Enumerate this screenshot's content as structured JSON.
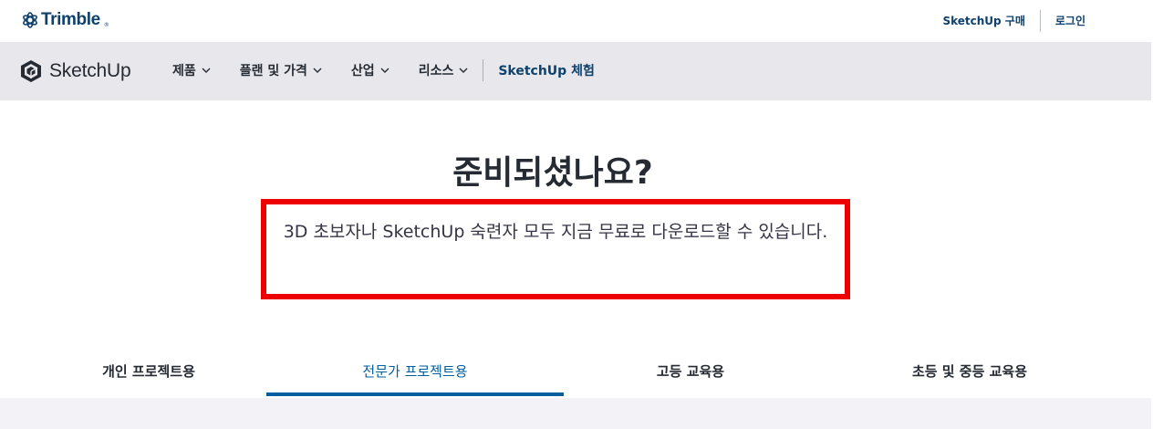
{
  "header": {
    "brand": "Trimble",
    "brand_tm": "®",
    "links": [
      "SketchUp 구매",
      "로그인"
    ]
  },
  "nav": {
    "product": "SketchUp",
    "items": [
      "제품",
      "플랜 및 가격",
      "산업",
      "리소스"
    ],
    "cta": "SketchUp 체험"
  },
  "hero": {
    "title": "준비되셨나요?",
    "subtitle": "3D 초보자나 SketchUp 숙련자 모두 지금 무료로 다운로드할 수 있습니다."
  },
  "tabs": {
    "items": [
      "개인 프로젝트용",
      "전문가 프로젝트용",
      "고등 교육용",
      "초등 및 중등 교육용"
    ],
    "active_index": 1
  },
  "colors": {
    "brand_blue": "#0e416c",
    "accent_blue": "#005f9e",
    "nav_bg": "#e8e8ec",
    "highlight_red": "#ee0000"
  },
  "icons": {
    "trimble_logo": "trimble-globe-icon",
    "sketchup_logo": "sketchup-cube-icon",
    "dropdown": "chevron-down-icon"
  }
}
